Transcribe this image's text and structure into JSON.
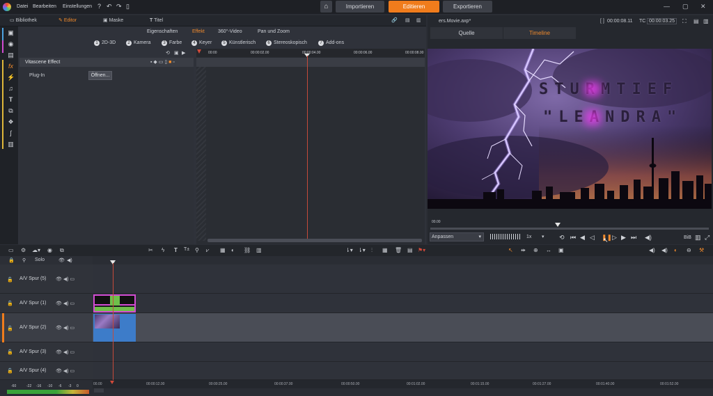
{
  "menu": {
    "items": [
      "Datei",
      "Bearbeiten",
      "Einstellungen"
    ]
  },
  "modes": {
    "import": "Importieren",
    "edit": "Editieren",
    "export": "Exportieren"
  },
  "tabs": {
    "library": "Bibliothek",
    "editor": "Editor",
    "mask": "Maske",
    "title": "Titel"
  },
  "subtabs": [
    "Eigenschaften",
    "Effekt",
    "360°-Video",
    "Pan und Zoom"
  ],
  "fx_categories": [
    {
      "n": "1",
      "label": "2D-3D"
    },
    {
      "n": "2",
      "label": "Kamera"
    },
    {
      "n": "3",
      "label": "Farbe"
    },
    {
      "n": "4",
      "label": "Keyer"
    },
    {
      "n": "5",
      "label": "Künstlerisch"
    },
    {
      "n": "6",
      "label": "Stereoskopisch"
    },
    {
      "n": "7",
      "label": "Add-ons"
    }
  ],
  "effect": {
    "name": "Vitascene Effect",
    "plugin_label": "Plug-In",
    "open_button": "Öffnen..."
  },
  "kf_ruler": [
    "00:00",
    "00:00:02.00",
    "00:00:04.00",
    "00:00:06.00",
    "00:00:08.00"
  ],
  "right": {
    "file": "ers.Movie.axp*",
    "timecode1": "00:00:08.11",
    "tc_label": "TC",
    "timecode2": "00:00:03.25",
    "tab_source": "Quelle",
    "tab_timeline": "Timeline",
    "scrub_start": "00.00",
    "fit": "Anpassen",
    "speed": "1x",
    "bib": "BiB"
  },
  "preview": {
    "title_line1": "STURMTIEF",
    "title_line2": "\"LEANDRA\""
  },
  "timeline": {
    "solo": "Solo",
    "tracks": [
      "A/V Spur (5)",
      "A/V Spur (1)",
      "A/V Spur (2)",
      "A/V Spur (3)",
      "A/V Spur (4)"
    ],
    "ruler": [
      "00.00",
      "00:00:12.00",
      "00:00:25.00",
      "00:00:37.00",
      "00:00:50.00",
      "00:01:02.00",
      "00:01:15.00",
      "00:01:27.00",
      "00:01:40.00",
      "00:01:52.00"
    ],
    "meter_ticks": [
      "-60",
      "-22",
      "-16",
      "-10",
      "-6",
      "-3",
      "0"
    ]
  },
  "colors": {
    "accent": "#f07c1c",
    "playhead": "#c64a3a",
    "clip_blue": "#3d7cc9",
    "clip_border": "#d24bd2"
  }
}
